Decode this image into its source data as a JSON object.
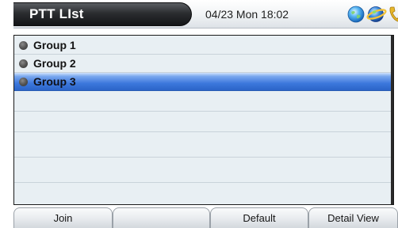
{
  "header": {
    "title": "PTT LIst",
    "datetime": "04/23 Mon 18:02",
    "icons": [
      "globe-status-icon",
      "network-status-icon",
      "phone-status-icon"
    ]
  },
  "list": {
    "items": [
      {
        "label": "Group 1",
        "selected": false
      },
      {
        "label": "Group 2",
        "selected": false
      },
      {
        "label": "Group 3",
        "selected": true
      }
    ]
  },
  "softkeys": {
    "left": "Join",
    "center_left": "",
    "center_right": "Default",
    "right": "Detail View"
  },
  "colors": {
    "selection": "#3d78dc",
    "list_background": "#e8eff3",
    "title_tab": "#2b2d30"
  }
}
